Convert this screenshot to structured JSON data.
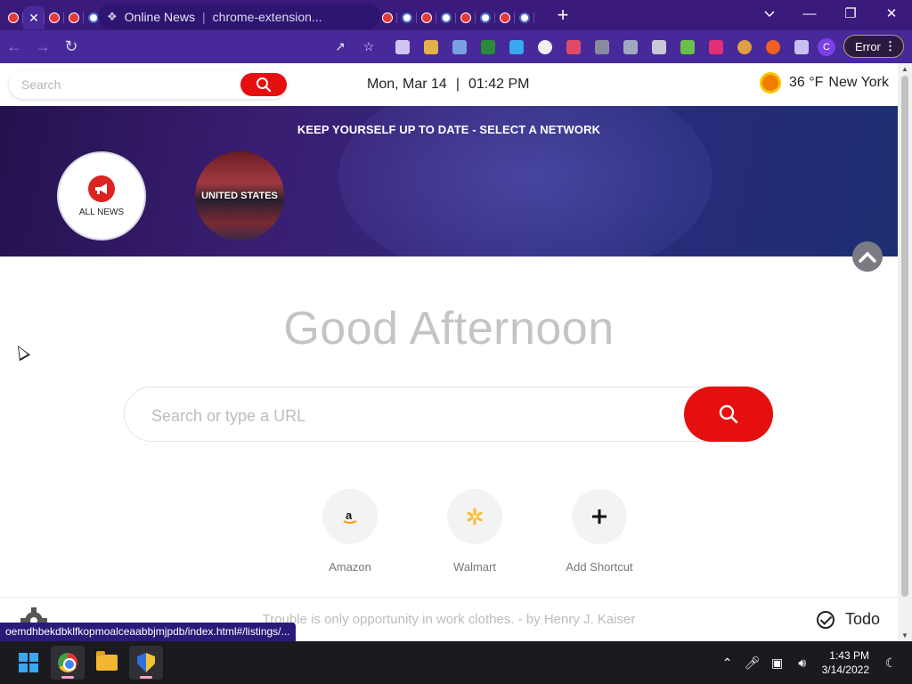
{
  "browser": {
    "tabs_count": 27,
    "active_tab_index": 1,
    "omnibox": {
      "site_name": "Online News",
      "url": "chrome-extension..."
    },
    "error_button_label": "Error",
    "profile_initial": "C",
    "extensions": [
      "hand-extension",
      "gallery-extension",
      "document-extension",
      "flag-extension",
      "play-extension",
      "search-lens-extension",
      "text-cursor-extension",
      "media-extension",
      "image-extension",
      "grid-extension",
      "color-bars-extension",
      "red-box-extension",
      "monkey-extension",
      "infinity-extension",
      "puzzle-extensions"
    ]
  },
  "topbar": {
    "search_placeholder": "Search",
    "date": "Mon, Mar 14",
    "separator": "|",
    "time": "01:42 PM",
    "temperature": "36 °F",
    "city": "New York"
  },
  "banner": {
    "title": "KEEP YOURSELF UP TO DATE - SELECT A NETWORK",
    "networks": [
      {
        "label": "ALL NEWS",
        "icon": "megaphone-icon"
      },
      {
        "label": "UNITED STATES",
        "icon": "us-flag-image"
      }
    ]
  },
  "main": {
    "greeting": "Good Afternoon",
    "search_placeholder": "Search or type a URL",
    "shortcuts": [
      {
        "name": "Amazon",
        "icon": "amazon-icon"
      },
      {
        "name": "Walmart",
        "icon": "walmart-icon"
      },
      {
        "name": "Add Shortcut",
        "icon": "plus-icon"
      }
    ]
  },
  "footer": {
    "quote": "Trouble is only opportunity in work clothes. - by Henry J. Kaiser",
    "todo_label": "Todo"
  },
  "status_url": "oemdhbekdbklfkopmoalceaabbjmjpdb/index.html#/listings/...",
  "taskbar": {
    "time": "1:43 PM",
    "date": "3/14/2022",
    "apps": [
      "windows-start",
      "chrome",
      "file-explorer",
      "security"
    ]
  },
  "colors": {
    "accent_red": "#e60f0f",
    "browser_purple": "#47299a"
  }
}
